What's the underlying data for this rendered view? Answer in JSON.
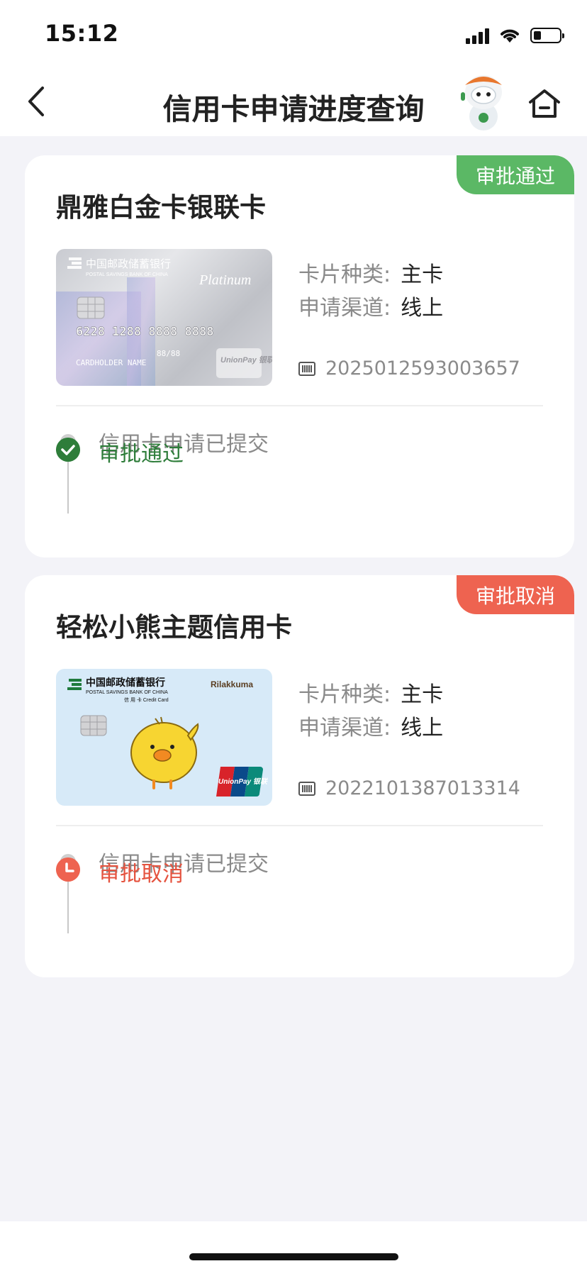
{
  "status_bar": {
    "time": "15:12"
  },
  "header": {
    "title": "信用卡申请进度查询"
  },
  "applications": [
    {
      "card_name": "鼎雅白金卡银联卡",
      "badge": "审批通过",
      "card_type_label": "卡片种类:",
      "card_type_value": "主卡",
      "channel_label": "申请渠道:",
      "channel_value": "线上",
      "application_no": "2025012593003657",
      "step1": "信用卡申请已提交",
      "step2": "审批通过",
      "card_image": {
        "bank_cn": "中国邮政储蓄银行",
        "bank_en": "POSTAL SAVINGS BANK OF CHINA",
        "tier": "Platinum",
        "number": "6228 1288 8888 8888",
        "expiry": "88/88",
        "holder": "CARDHOLDER NAME",
        "network": "UnionPay 银联"
      }
    },
    {
      "card_name": "轻松小熊主题信用卡",
      "badge": "审批取消",
      "card_type_label": "卡片种类:",
      "card_type_value": "主卡",
      "channel_label": "申请渠道:",
      "channel_value": "线上",
      "application_no": "2022101387013314",
      "step1": "信用卡申请已提交",
      "step2": "审批取消",
      "card_image": {
        "bank_cn": "中国邮政储蓄银行",
        "bank_en": "POSTAL SAVINGS BANK OF CHINA",
        "sub": "信 用 卡 Credit Card",
        "brand": "Rilakkuma",
        "network": "UnionPay 银联"
      }
    }
  ],
  "colors": {
    "approved": "#5bb865",
    "approved_text": "#2e7d3a",
    "cancelled": "#ee6350"
  }
}
